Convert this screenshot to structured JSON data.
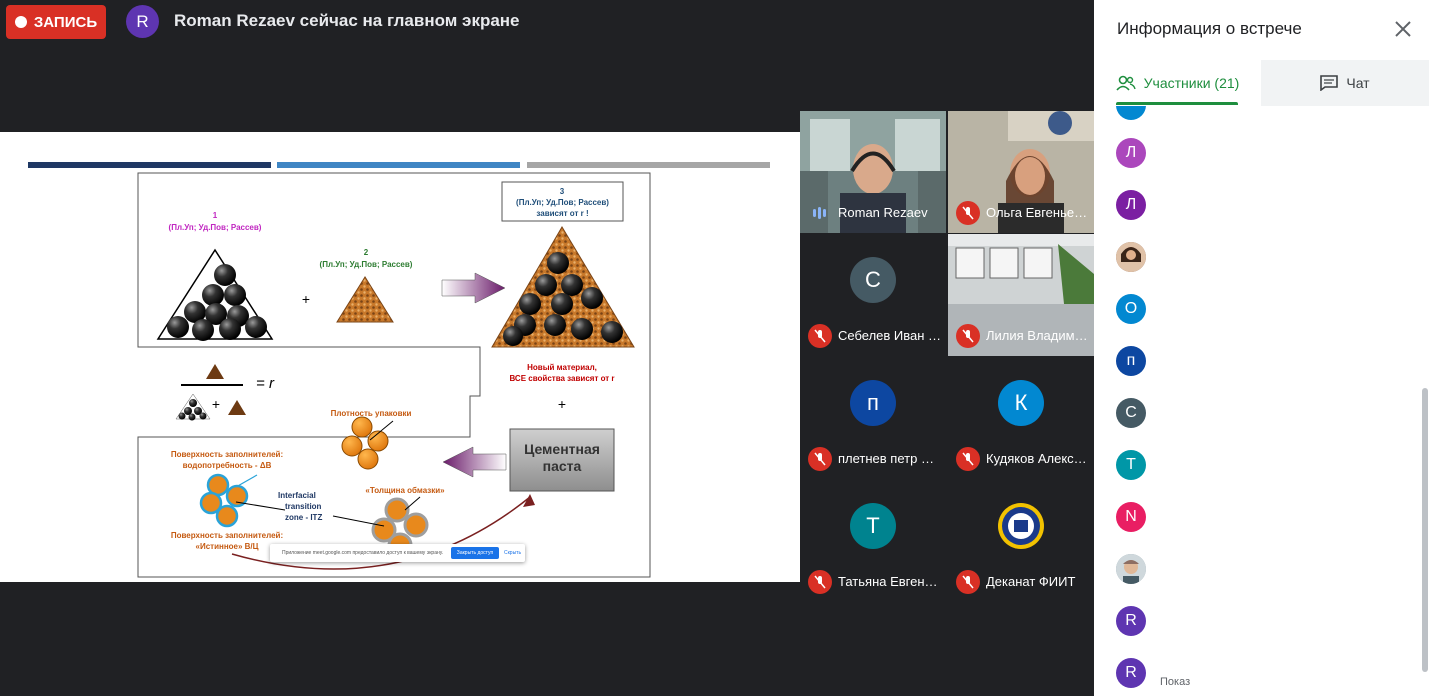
{
  "recording": {
    "label": "ЗАПИСЬ",
    "color": "#d93025"
  },
  "presenter": {
    "initial": "R",
    "text": "Roman Rezaev сейчас на главном экране"
  },
  "slide": {
    "bar_colors": [
      "#1f3864",
      "#3f86c4",
      "#a6a6a6"
    ],
    "label1_num": "1",
    "label1_props": "(Пл.Уп;  Уд.Пов; Рассев)",
    "label2_num": "2",
    "label2_props": "(Пл.Уп;  Уд.Пов; Рассев)",
    "label3_num": "3",
    "label3_props": "(Пл.Уп;  Уд.Пов; Рассев)",
    "label3_dep": "зависят от r !",
    "plus1": "+",
    "new_material_1": "Новый материал,",
    "new_material_2": "ВСЕ свойства зависят от r",
    "plus2": "+",
    "plus3": "+",
    "eq_r": "= r",
    "packing_density": "Плотность упаковки",
    "cement_paste": "Цементная паста",
    "surface_water_1": "Поверхность заполнителей:",
    "surface_water_2": "водопотребность - ΔВ",
    "itz_1": "Interfacial",
    "itz_2": "transition",
    "itz_3": "zone - ITZ",
    "coating": "«Толщина обмазки»",
    "surface_true_1": "Поверхность заполнителей:",
    "surface_true_2": "«Истинное» В/Ц",
    "notice_text": "Приложение meet.google.com предоставило доступ к вашему экрану.",
    "notice_close": "Закрыть доступ",
    "notice_hide": "Скрыть"
  },
  "tiles": [
    {
      "name": "Roman Rezaev",
      "type": "video",
      "mic": "speaking"
    },
    {
      "name": "Ольга Евгенье…",
      "type": "video",
      "mic": "muted"
    },
    {
      "name": "Себелев Иван …",
      "initial": "С",
      "color": "#455a64",
      "mic": "muted"
    },
    {
      "name": "Лилия Владим…",
      "type": "video",
      "mic": "muted"
    },
    {
      "name": "плетнев петр …",
      "initial": "п",
      "color": "#0d47a1",
      "mic": "muted"
    },
    {
      "name": "Кудяков Алекс…",
      "initial": "К",
      "color": "#0288d1",
      "mic": "muted"
    },
    {
      "name": "Татьяна Евген…",
      "initial": "Т",
      "color": "#00838f",
      "mic": "muted"
    },
    {
      "name": "Деканат ФИИТ",
      "type": "logo",
      "mic": "muted"
    }
  ],
  "panel": {
    "title": "Информация о встрече",
    "tab_people": "Участники (21)",
    "tab_chat": "Чат",
    "participants": [
      {
        "initial": "Л",
        "color": "#ab47bc"
      },
      {
        "initial": "Л",
        "color": "#7b1fa2"
      },
      {
        "initial": "",
        "color": "#8d6e63",
        "photo": true
      },
      {
        "initial": "О",
        "color": "#0288d1"
      },
      {
        "initial": "п",
        "color": "#0d47a1"
      },
      {
        "initial": "С",
        "color": "#455a64"
      },
      {
        "initial": "Т",
        "color": "#0097a7"
      },
      {
        "initial": "N",
        "color": "#e91e63"
      },
      {
        "initial": "",
        "color": "#90a4ae",
        "photo": true
      },
      {
        "initial": "R",
        "color": "#5e35b1"
      },
      {
        "initial": "R",
        "color": "#5e35b1"
      }
    ],
    "bottom_partial": "Показ"
  }
}
